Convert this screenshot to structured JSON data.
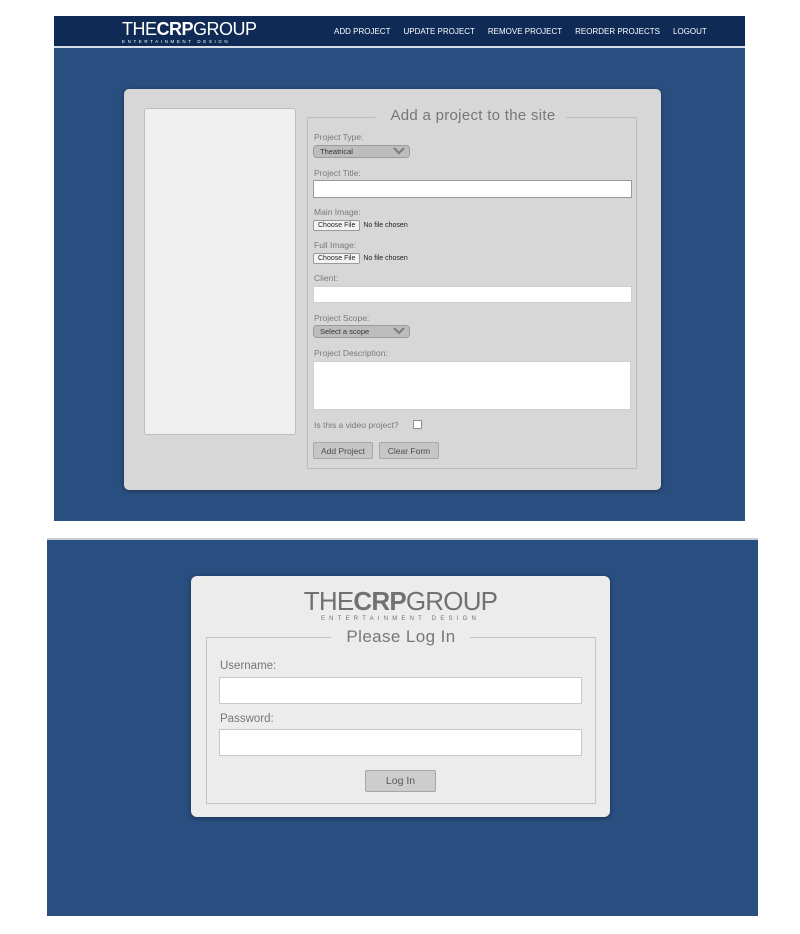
{
  "admin": {
    "logo": {
      "the": "THE",
      "crp": "CRP",
      "group": "GROUP",
      "tagline": "ENTERTAINMENT DESIGN"
    },
    "nav": [
      {
        "label": "ADD PROJECT"
      },
      {
        "label": "UPDATE PROJECT"
      },
      {
        "label": "REMOVE PROJECT"
      },
      {
        "label": "REORDER PROJECTS"
      },
      {
        "label": "LOGOUT"
      }
    ],
    "form": {
      "legend": "Add a project to the site",
      "project_type_label": "Project Type:",
      "project_type_value": "Theatrical",
      "project_title_label": "Project Title:",
      "project_title_value": "",
      "main_image_label": "Main Image:",
      "full_image_label": "Full Image:",
      "choose_file": "Choose File",
      "no_file": "No file chosen",
      "client_label": "Client:",
      "client_value": "",
      "project_scope_label": "Project Scope:",
      "project_scope_value": "Select a scope",
      "description_label": "Project Description:",
      "description_value": "",
      "video_label": "Is this a video project?",
      "video_checked": false,
      "add_button": "Add Project",
      "clear_button": "Clear Form"
    },
    "colors": {
      "background": "#294f80",
      "topbar": "#0f2b55",
      "card": "#d7d7d7"
    }
  },
  "login": {
    "logo": {
      "the": "THE",
      "crp": "CRP",
      "group": "GROUP",
      "tagline": "ENTERTAINMENT DESIGN"
    },
    "legend": "Please Log In",
    "username_label": "Username:",
    "username_value": "",
    "password_label": "Password:",
    "password_value": "",
    "login_button": "Log In",
    "colors": {
      "background": "#294f80",
      "card": "#ececec"
    }
  }
}
